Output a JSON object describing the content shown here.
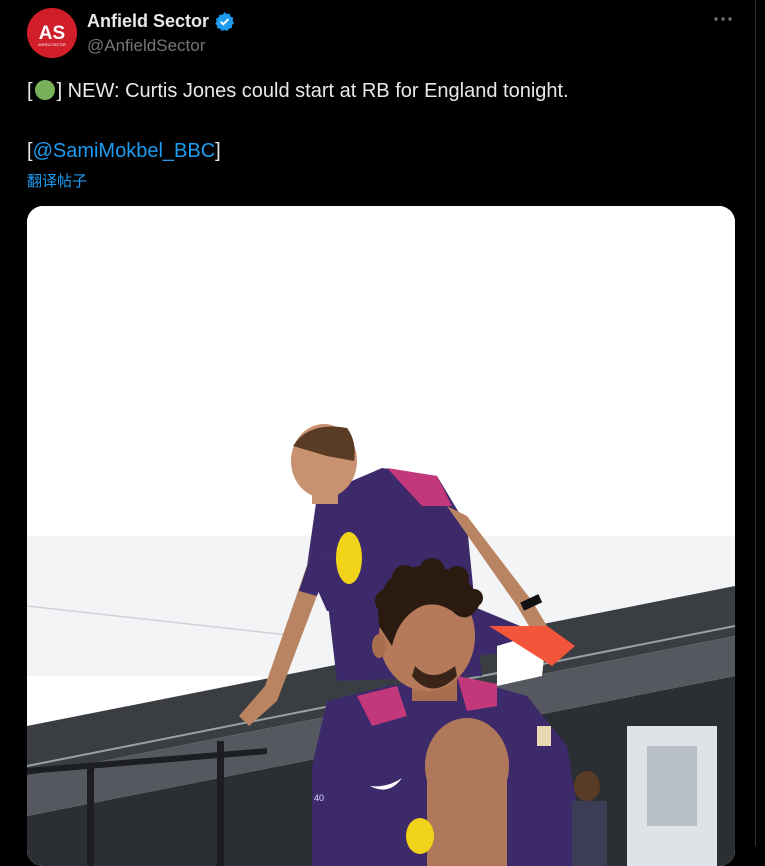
{
  "account": {
    "display_name": "Anfield Sector",
    "handle": "@AnfieldSector",
    "avatar_initials": "AS",
    "avatar_subtext": "ANFIELD SECTOR",
    "verified": true
  },
  "tweet": {
    "text_open": "[",
    "text_emoji": "green-circle-emoji",
    "text_main": "] NEW: Curtis Jones could start at RB for England tonight.",
    "source_open": "[",
    "mention": "@SamiMokbel_BBC",
    "source_close": "]",
    "translate_label": "翻译帖子"
  },
  "colors": {
    "background": "#000000",
    "text": "#e7e9ea",
    "secondary_text": "#71767b",
    "link": "#1d9bf0",
    "avatar_red": "#d01f2a",
    "kit_purple": "#3d2a6b",
    "kit_pink": "#c2387a"
  },
  "icons": {
    "verified": "verified-badge-icon",
    "more": "more-dots-icon"
  }
}
